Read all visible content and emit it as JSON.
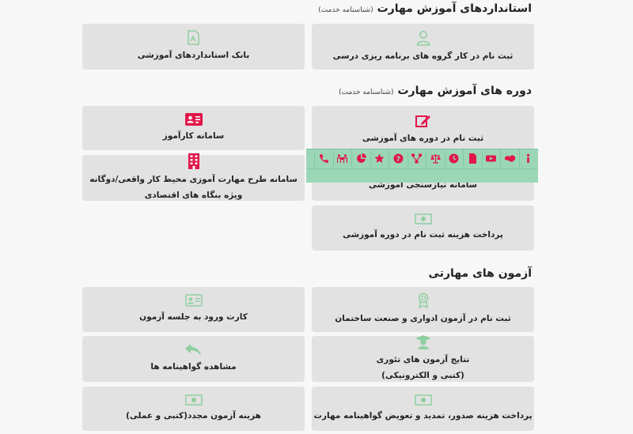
{
  "sections": {
    "standards": {
      "title": "استانداردهای آموزش مهارت",
      "subtitle": "(شناسنامه خدمت)"
    },
    "courses": {
      "title": "دوره های آموزش مهارت",
      "subtitle": "(شناسنامه خدمت)"
    },
    "exams": {
      "title": "آزمون های مهارتی"
    }
  },
  "cards": {
    "register_curriculum_group": "ثبت نام در کار گروه های برنامه ریزی درسی",
    "standards_bank": "بانک استانداردهای آموزشی",
    "register_courses": "ثبت نام در دوره های آموزشی",
    "trainee_system": "سامانه کارآموز",
    "needs_assessment": "سامانه نیازسنجی آموزشی",
    "workplace_line1": "سامانه طرح مهارت آموزی محیط کار واقعی/دوگانه",
    "workplace_line2": "ویژه بنگاه های اقتصادی",
    "course_fee_payment": "پرداخت هزینه ثبت نام در دوره آموزشی",
    "construction_exam": "ثبت نام در آزمون ادواری و صنعت ساختمان",
    "entry_card": "کارت ورود به جلسه آزمون",
    "theory_results_line1": "نتایج آزمون های تئوری",
    "theory_results_line2": "(کتبی و الکترونیکی)",
    "view_certificates": "مشاهده گواهینامه ها",
    "certificate_fee": "پرداخت هزینه صدور، تمدید و تعویض گواهینامه مهارت",
    "retake_fee": "هزینه آزمون مجدد(کتبی و عملی)"
  },
  "colors": {
    "accent_red": "#e0184a",
    "icon_green": "#8fcf9f",
    "toolbar_bg": "#9bd7b7",
    "card_bg": "#e2e2e2"
  },
  "toolbar_icons": [
    "info-icon",
    "handshake-icon",
    "video-icon",
    "document-icon",
    "clock-icon",
    "scale-icon",
    "sitemap-icon",
    "question-icon",
    "star-icon",
    "pie-chart-icon",
    "meeting-icon",
    "phone-icon"
  ]
}
